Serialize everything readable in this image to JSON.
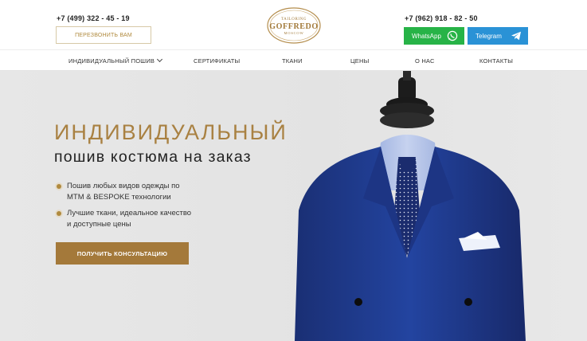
{
  "header": {
    "phone_left": "+7 (499) 322 - 45 - 19",
    "phone_right": "+7 (962) 918 - 82 - 50",
    "callback_label": "ПЕРЕЗВОНИТЬ ВАМ",
    "whatsapp_label": "WhatsApp",
    "telegram_label": "Telegram",
    "logo": {
      "top": "TAILORING",
      "main": "GOFFREDO",
      "sub": "MOSCOW"
    }
  },
  "nav": {
    "items": [
      {
        "label": "ИНДИВИДУАЛЬНЫЙ ПОШИВ"
      },
      {
        "label": "СЕРТИФИКАТЫ"
      },
      {
        "label": "ТКАНИ"
      },
      {
        "label": "ЦЕНЫ"
      },
      {
        "label": "О НАС"
      },
      {
        "label": "КОНТАКТЫ"
      }
    ]
  },
  "hero": {
    "title": "ИНДИВИДУАЛЬНЫЙ",
    "subtitle": "пошив костюма на заказ",
    "bullets": [
      {
        "line1": "Пошив любых видов одежды по",
        "line2": "MTM & BESPOKE технологии"
      },
      {
        "line1": "Лучшие ткани, идеальное качество",
        "line2": "и доступные цены"
      }
    ],
    "cta_label": "ПОЛУЧИТЬ КОНСУЛЬТАЦИЮ"
  },
  "colors": {
    "accent_gold": "#a98142",
    "whatsapp": "#27b347",
    "telegram": "#2a92d6",
    "suit_blue": "#1f3a8a"
  }
}
